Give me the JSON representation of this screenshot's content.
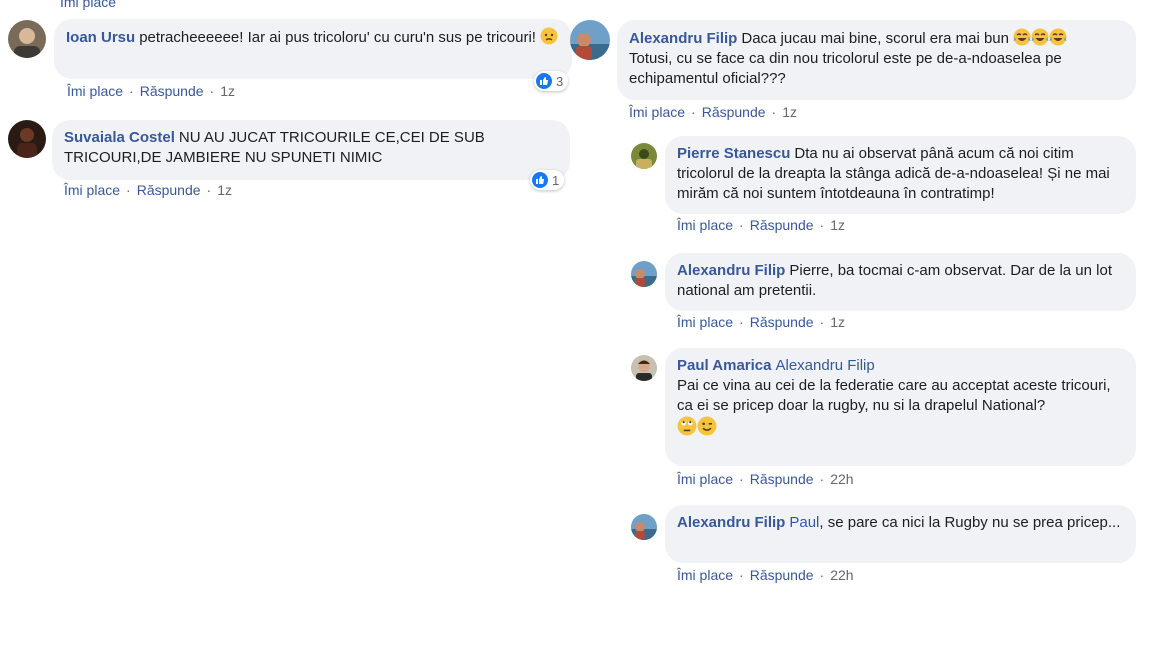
{
  "actions": {
    "like": "Îmi place",
    "reply": "Răspunde",
    "sep": "·"
  },
  "comments": [
    {
      "author": "Ioan Ursu",
      "text": "petracheeeeee! Iar ai pus tricoloru' cu curu'n sus pe tricouri!",
      "emoji": "angry-face",
      "time": "1z",
      "reactions": "3"
    },
    {
      "author": "Suvaiala Costel",
      "text": "NU AU JUCAT TRICOURILE CE,CEI DE SUB TRICOURI,DE JAMBIERE NU SPUNETI NIMIC",
      "time": "1z",
      "reactions": "1"
    },
    {
      "author": "Alexandru Filip",
      "text": "Daca jucau mai bine, scorul era mai bun",
      "emoji": "tears-of-joy",
      "text2": "Totusi, cu se face ca din nou tricolorul este pe de-a-ndoaselea pe echipamentul oficial???",
      "time": "1z"
    }
  ],
  "replies": [
    {
      "author": "Pierre Stanescu",
      "text": "Dta nu ai observat până acum că noi citim tricolorul de la dreapta la stânga adică de-a-ndoaselea! Și ne mai mirăm că noi suntem întotdeauna în contratimp!",
      "time": "1z"
    },
    {
      "author": "Alexandru Filip",
      "text": "Pierre, ba tocmai c-am observat. Dar de la un lot national am pretentii.",
      "time": "1z"
    },
    {
      "author": "Paul Amarica",
      "mention": "Alexandru Filip",
      "text": "Pai ce vina au cei de la federatie care au acceptat aceste tricouri, ca ei se pricep doar la rugby, nu si la drapelul National?",
      "emoji": "eye-roll-wink",
      "time": "22h"
    },
    {
      "author": "Alexandru Filip",
      "mention": "Paul",
      "text": ", se pare ca nici la Rugby nu se prea pricep...",
      "time": "22h"
    }
  ]
}
